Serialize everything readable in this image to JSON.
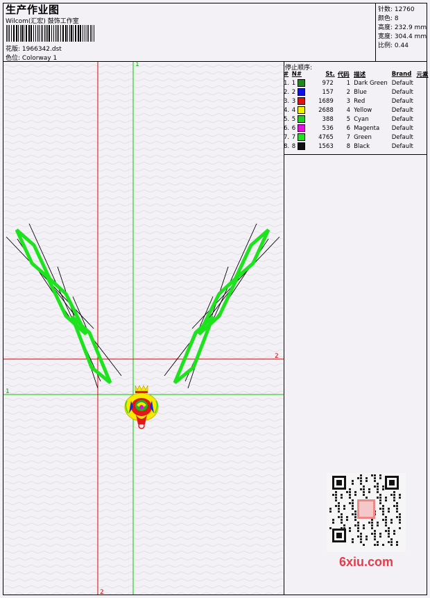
{
  "header": {
    "title": "生产作业图",
    "company": "Wilcom(汇宏) 鼓饰工作室",
    "design_label": "花版:",
    "design_value": "1966342.dst",
    "colorway_label": "色位:",
    "colorway_value": "Colorway 1"
  },
  "stats": {
    "stitches_label": "针数:",
    "stitches_value": "12760",
    "colors_label": "颜色:",
    "colors_value": "8",
    "height_label": "高度:",
    "height_value": "232.9 mm",
    "width_label": "宽度:",
    "width_value": "304.4 mm",
    "scale_label": "比例:",
    "scale_value": "0.44"
  },
  "legend": {
    "title": "停止顺序:",
    "headers": [
      "#",
      "N#",
      "St.",
      "代码",
      "描述",
      "Brand",
      "元素"
    ],
    "rows": [
      {
        "idx": "1.",
        "n": "1",
        "color": "#1a8a1a",
        "st": "972",
        "code": "1",
        "desc": "Dark Green",
        "brand": "Default"
      },
      {
        "idx": "2.",
        "n": "2",
        "color": "#1010e0",
        "st": "157",
        "code": "2",
        "desc": "Blue",
        "brand": "Default"
      },
      {
        "idx": "3.",
        "n": "3",
        "color": "#e01010",
        "st": "1689",
        "code": "3",
        "desc": "Red",
        "brand": "Default"
      },
      {
        "idx": "4.",
        "n": "4",
        "color": "#f0f000",
        "st": "2688",
        "code": "4",
        "desc": "Yellow",
        "brand": "Default"
      },
      {
        "idx": "5.",
        "n": "5",
        "color": "#20d020",
        "st": "388",
        "code": "5",
        "desc": "Cyan",
        "brand": "Default"
      },
      {
        "idx": "6.",
        "n": "6",
        "color": "#e010e0",
        "st": "536",
        "code": "6",
        "desc": "Magenta",
        "brand": "Default"
      },
      {
        "idx": "7.",
        "n": "7",
        "color": "#20e020",
        "st": "4765",
        "code": "7",
        "desc": "Green",
        "brand": "Default"
      },
      {
        "idx": "8.",
        "n": "8",
        "color": "#101010",
        "st": "1563",
        "code": "8",
        "desc": "Black",
        "brand": "Default"
      }
    ]
  },
  "canvas": {
    "axis_top_label": "1",
    "axis_right_label": "2",
    "axis_left_label": "1",
    "axis_bottom_label": "2",
    "guide_colors": {
      "green": "#00cc00",
      "red": "#dd0000"
    }
  },
  "watermark": {
    "text": "6xiu.com"
  }
}
